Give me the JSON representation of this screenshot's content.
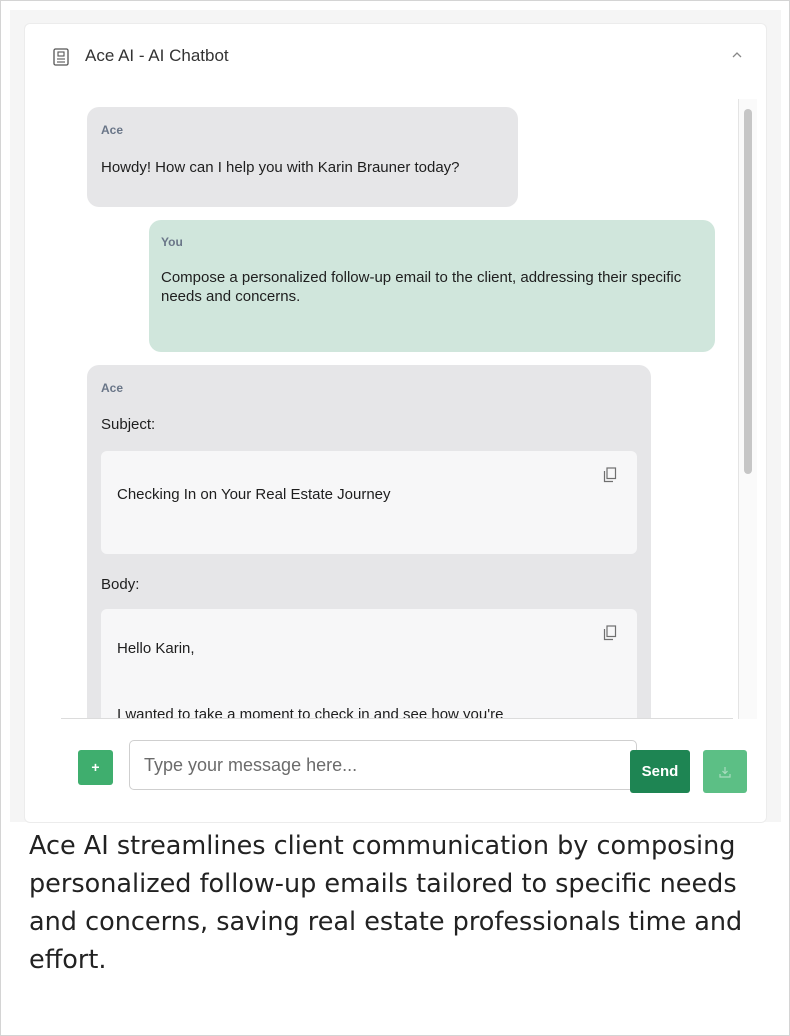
{
  "widget": {
    "title": "Ace AI - AI Chatbot",
    "icons": {
      "header": "document-icon",
      "collapse": "chevron-up-icon",
      "copy": "copy-icon",
      "download": "download-icon"
    }
  },
  "chat": {
    "messages": [
      {
        "sender": "Ace",
        "text": "Howdy! How can I help you with Karin Brauner today?"
      },
      {
        "sender": "You",
        "text": "Compose a personalized follow-up email to the client, addressing their specific needs and concerns."
      },
      {
        "sender": "Ace",
        "subject_label": "Subject:",
        "subject_text": "Checking In on Your Real Estate Journey",
        "body_label": "Body:",
        "body_greeting": "Hello Karin,",
        "body_partial": "I wanted to take a moment to check in and see how you're"
      }
    ]
  },
  "composer": {
    "add_label": "+",
    "placeholder": "Type your message here...",
    "send_label": "Send"
  },
  "caption": "Ace AI streamlines client communication by composing personalized follow-up emails tailored to specific needs and concerns, saving real estate professionals time and effort.",
  "colors": {
    "ace_bubble": "#e6e6e8",
    "user_bubble": "#d0e6dc",
    "send_button": "#1e8553",
    "accent_green": "#3fae6e"
  }
}
